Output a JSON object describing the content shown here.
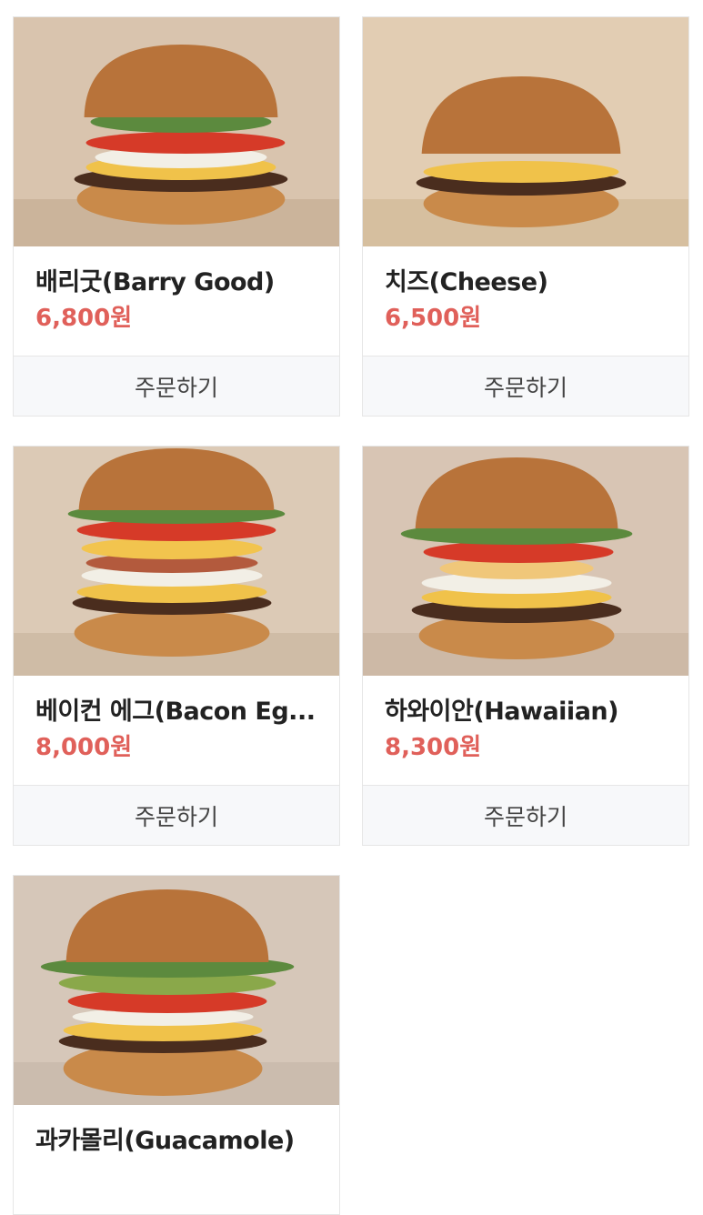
{
  "menu": {
    "order_label": "주문하기",
    "currency_unit": "원",
    "items": [
      {
        "name": "배리굿(Barry Good)",
        "price": "6,800",
        "image": "barry-good-burger-photo",
        "bg": "#d9c4ae"
      },
      {
        "name": "치즈(Cheese)",
        "price": "6,500",
        "image": "cheese-burger-photo",
        "bg": "#e2cdb3"
      },
      {
        "name": "베이컨 에그(Bacon Eg...",
        "price": "8,000",
        "image": "bacon-egg-burger-photo",
        "bg": "#dccab6"
      },
      {
        "name": "하와이안(Hawaiian)",
        "price": "8,300",
        "image": "hawaiian-burger-photo",
        "bg": "#d8c5b4"
      },
      {
        "name": "과카몰리(Guacamole)",
        "price": "",
        "image": "guacamole-burger-photo",
        "bg": "#d6c7b9"
      }
    ]
  },
  "colors": {
    "price": "#e0605a",
    "order_bg": "#f7f8fa",
    "border": "#e6e6e6"
  }
}
